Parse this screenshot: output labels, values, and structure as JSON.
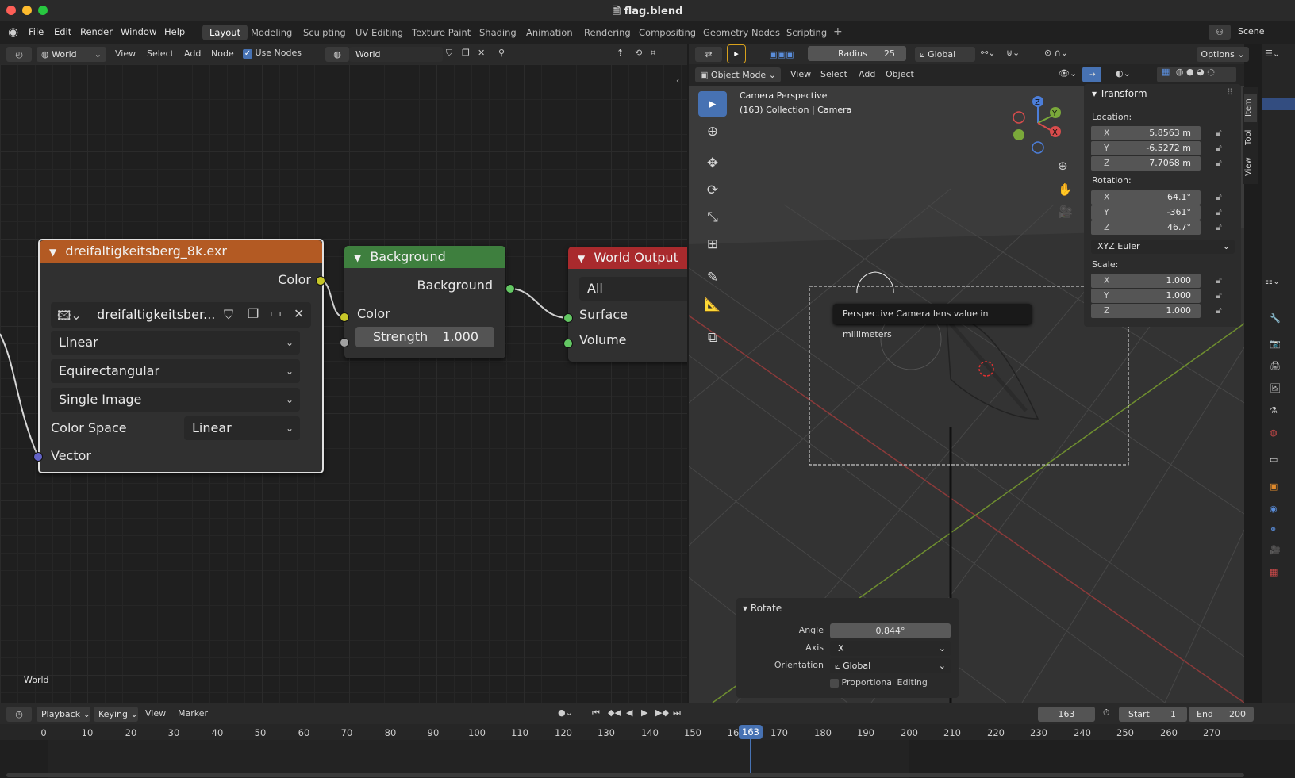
{
  "window": {
    "title": "flag.blend",
    "file_icon": "blend-file-icon"
  },
  "menu": {
    "items": [
      "File",
      "Edit",
      "Render",
      "Window",
      "Help"
    ],
    "workspaces": [
      "Layout",
      "Modeling",
      "Sculpting",
      "UV Editing",
      "Texture Paint",
      "Shading",
      "Animation",
      "Rendering",
      "Compositing",
      "Geometry Nodes",
      "Scripting"
    ],
    "active_workspace": "Layout",
    "scene": "Scene"
  },
  "node_header": {
    "shader_type": "World",
    "menus": [
      "View",
      "Select",
      "Add",
      "Node"
    ],
    "use_nodes_label": "Use Nodes",
    "use_nodes_checked": true,
    "world_name": "World"
  },
  "node_editor": {
    "context_label": "World",
    "image_node": {
      "title": "dreifaltigkeitsberg_8k.exr",
      "output": "Color",
      "image_name": "dreifaltigkeitsber...",
      "interpolation": "Linear",
      "projection": "Equirectangular",
      "source": "Single Image",
      "color_space_label": "Color Space",
      "color_space": "Linear",
      "input": "Vector",
      "header_color": "#b35a23"
    },
    "background_node": {
      "title": "Background",
      "output": "Background",
      "color_input": "Color",
      "strength_label": "Strength",
      "strength_value": "1.000",
      "header_color": "#3e7f3e"
    },
    "output_node": {
      "title": "World Output",
      "target": "All",
      "surface": "Surface",
      "volume": "Volume",
      "header_color": "#a92a2d"
    }
  },
  "viewport_header": {
    "radius_label": "Radius",
    "radius_value": "25",
    "orientation": "Global",
    "options": "Options",
    "mode": "Object Mode",
    "menus": [
      "View",
      "Select",
      "Add",
      "Object"
    ]
  },
  "viewport": {
    "perspective": "Camera Perspective",
    "collection": "(163) Collection | Camera",
    "tooltip": "Perspective Camera lens value in millimeters",
    "gizmo": {
      "z": "Z",
      "y": "Y",
      "x": "X"
    }
  },
  "n_panel": {
    "section": "Transform",
    "tabs": [
      "Item",
      "Tool",
      "View"
    ],
    "location_label": "Location:",
    "location": [
      {
        "axis": "X",
        "value": "5.8563 m"
      },
      {
        "axis": "Y",
        "value": "-6.5272 m"
      },
      {
        "axis": "Z",
        "value": "7.7068 m"
      }
    ],
    "rotation_label": "Rotation:",
    "rotation": [
      {
        "axis": "X",
        "value": "64.1°"
      },
      {
        "axis": "Y",
        "value": "-361°"
      },
      {
        "axis": "Z",
        "value": "46.7°"
      }
    ],
    "rotation_mode": "XYZ Euler",
    "scale_label": "Scale:",
    "scale": [
      {
        "axis": "X",
        "value": "1.000"
      },
      {
        "axis": "Y",
        "value": "1.000"
      },
      {
        "axis": "Z",
        "value": "1.000"
      }
    ]
  },
  "operator_panel": {
    "title": "Rotate",
    "angle_label": "Angle",
    "angle_value": "0.844°",
    "axis_label": "Axis",
    "axis_value": "X",
    "orientation_label": "Orientation",
    "orientation_value": "Global",
    "proportional_label": "Proportional Editing",
    "proportional_checked": false
  },
  "timeline": {
    "menus": [
      "Playback",
      "Keying",
      "View",
      "Marker"
    ],
    "current_frame": "163",
    "start_label": "Start",
    "start": "1",
    "end_label": "End",
    "end": "200",
    "ticks": [
      "0",
      "10",
      "20",
      "30",
      "40",
      "50",
      "60",
      "70",
      "80",
      "90",
      "100",
      "110",
      "120",
      "130",
      "140",
      "150",
      "16",
      "170",
      "180",
      "190",
      "200",
      "210",
      "220",
      "230",
      "240",
      "250",
      "260",
      "270"
    ],
    "playhead_label": "163"
  }
}
